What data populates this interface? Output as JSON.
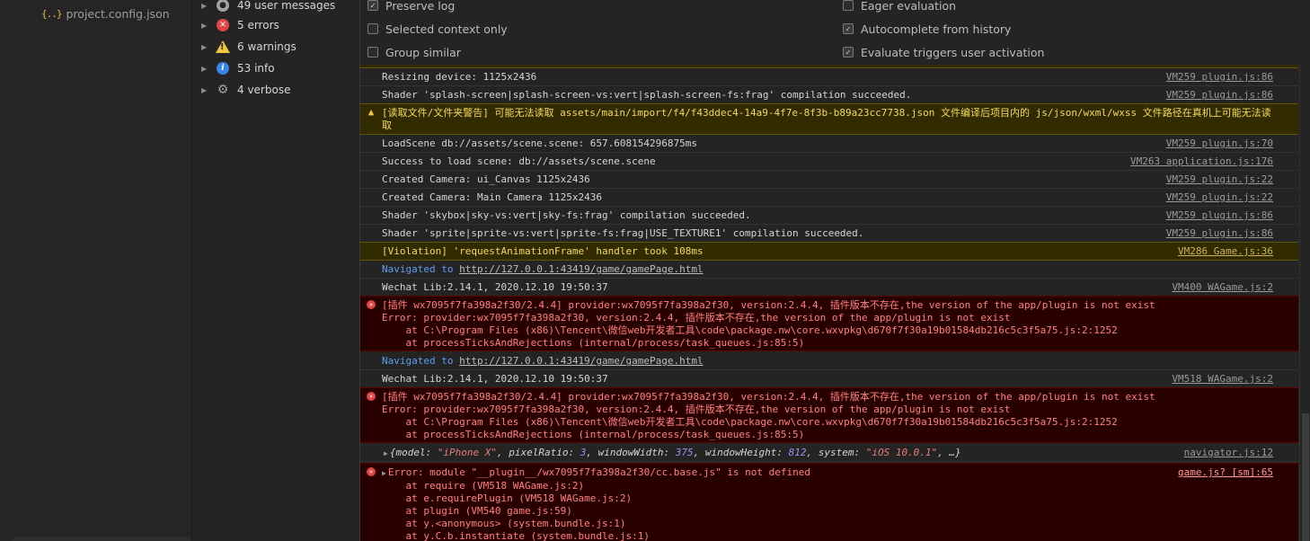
{
  "filetree": {
    "file_name": "project.config.json",
    "file_icon": "{..}"
  },
  "sidebar": {
    "items": [
      {
        "label": "49 user messages",
        "icon": "user-icon"
      },
      {
        "label": "5 errors",
        "icon": "error-icon"
      },
      {
        "label": "6 warnings",
        "icon": "warning-icon"
      },
      {
        "label": "53 info",
        "icon": "info-icon"
      },
      {
        "label": "4 verbose",
        "icon": "gear-icon"
      }
    ]
  },
  "settings": {
    "left": [
      {
        "label": "Preserve log",
        "checked": true
      },
      {
        "label": "Selected context only",
        "checked": false
      },
      {
        "label": "Group similar",
        "checked": false
      }
    ],
    "right": [
      {
        "label": "Eager evaluation",
        "checked": false
      },
      {
        "label": "Autocomplete from history",
        "checked": true
      },
      {
        "label": "Evaluate triggers user activation",
        "checked": true
      }
    ]
  },
  "messages": [
    {
      "type": "log",
      "text": "Resizing device: 1125x2436",
      "source": "VM259 plugin.js:86"
    },
    {
      "type": "log",
      "text": "Shader 'splash-screen|splash-screen-vs:vert|splash-screen-fs:frag' compilation succeeded.",
      "source": "VM259 plugin.js:86"
    },
    {
      "type": "warn",
      "text": "[读取文件/文件夹警告] 可能无法读取 assets/main/import/f4/f43ddec4-14a9-4f7e-8f3b-b89a23cc7738.json 文件编译后项目内的 js/json/wxml/wxss 文件路径在真机上可能无法读取",
      "source": ""
    },
    {
      "type": "log",
      "text": "LoadScene db://assets/scene.scene: 657.608154296875ms",
      "source": "VM259 plugin.js:70"
    },
    {
      "type": "log",
      "text": "Success to load scene: db://assets/scene.scene",
      "source": "VM263 application.js:176"
    },
    {
      "type": "log",
      "text": "Created Camera: ui_Canvas 1125x2436",
      "source": "VM259 plugin.js:22"
    },
    {
      "type": "log",
      "text": "Created Camera: Main Camera 1125x2436",
      "source": "VM259 plugin.js:22"
    },
    {
      "type": "log",
      "text": "Shader 'skybox|sky-vs:vert|sky-fs:frag' compilation succeeded.",
      "source": "VM259 plugin.js:86"
    },
    {
      "type": "log",
      "text": "Shader 'sprite|sprite-vs:vert|sprite-fs:frag|USE_TEXTURE1' compilation succeeded.",
      "source": "VM259 plugin.js:86"
    },
    {
      "type": "violation",
      "text": "[Violation] 'requestAnimationFrame' handler took 108ms",
      "source": "VM286 Game.js:36"
    },
    {
      "type": "nav",
      "label": "Navigated to",
      "url": "http://127.0.0.1:43419/game/gamePage.html"
    },
    {
      "type": "log",
      "text": "Wechat Lib:2.14.1, 2020.12.10 19:50:37",
      "source": "VM400 WAGame.js:2"
    },
    {
      "type": "error",
      "lines": [
        "[插件 wx7095f7fa398a2f30/2.4.4] provider:wx7095f7fa398a2f30, version:2.4.4, 插件版本不存在,the version of the app/plugin is not exist",
        "Error: provider:wx7095f7fa398a2f30, version:2.4.4, 插件版本不存在,the version of the app/plugin is not exist",
        "    at C:\\Program Files (x86)\\Tencent\\微信web开发者工具\\code\\package.nw\\core.wxvpkg\\d670f7f30a19b01584db216c5c3f5a75.js:2:1252",
        "    at processTicksAndRejections (internal/process/task_queues.js:85:5)"
      ]
    },
    {
      "type": "nav",
      "label": "Navigated to",
      "url": "http://127.0.0.1:43419/game/gamePage.html"
    },
    {
      "type": "log",
      "text": "Wechat Lib:2.14.1, 2020.12.10 19:50:37",
      "source": "VM518 WAGame.js:2"
    },
    {
      "type": "error",
      "lines": [
        "[插件 wx7095f7fa398a2f30/2.4.4] provider:wx7095f7fa398a2f30, version:2.4.4, 插件版本不存在,the version of the app/plugin is not exist",
        "Error: provider:wx7095f7fa398a2f30, version:2.4.4, 插件版本不存在,the version of the app/plugin is not exist",
        "    at C:\\Program Files (x86)\\Tencent\\微信web开发者工具\\code\\package.nw\\core.wxvpkg\\d670f7f30a19b01584db216c5c3f5a75.js:2:1252",
        "    at processTicksAndRejections (internal/process/task_queues.js:85:5)"
      ]
    },
    {
      "type": "object",
      "source": "navigator.js:12",
      "parts": [
        {
          "k": "model: ",
          "v": "\"iPhone X\"",
          "t": "s"
        },
        {
          "k": "pixelRatio: ",
          "v": "3",
          "t": "n"
        },
        {
          "k": "windowWidth: ",
          "v": "375",
          "t": "n"
        },
        {
          "k": "windowHeight: ",
          "v": "812",
          "t": "n"
        },
        {
          "k": "system: ",
          "v": "\"iOS 10.0.1\"",
          "t": "s"
        }
      ]
    },
    {
      "type": "error",
      "source": "game.js? [sm]:65",
      "lines": [
        "Error: module \"__plugin__/wx7095f7fa398a2f30/cc.base.js\" is not defined",
        "    at require (VM518 WAGame.js:2)",
        "    at e.requirePlugin (VM518 WAGame.js:2)",
        "    at plugin (VM540 game.js:59)",
        "    at y.<anonymous> (system.bundle.js:1)",
        "    at y.C.b.instantiate (system.bundle.js:1)"
      ]
    }
  ]
}
